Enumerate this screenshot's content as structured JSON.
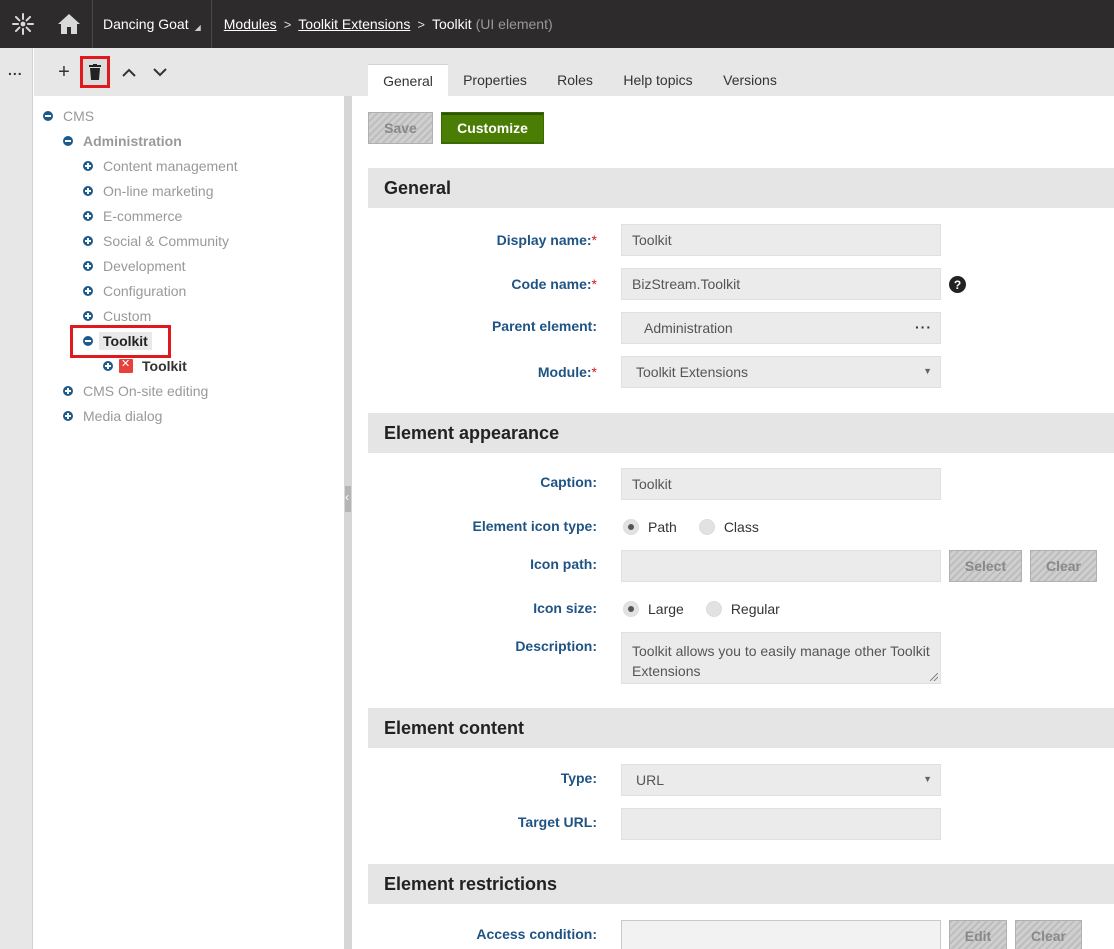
{
  "topbar": {
    "site": "Dancing Goat",
    "breadcrumbs": [
      {
        "label": "Modules",
        "link": true
      },
      {
        "label": "Toolkit Extensions",
        "link": true
      }
    ],
    "current": "Toolkit",
    "current_suffix": "(UI element)"
  },
  "strip": {
    "more": "..."
  },
  "tree_toolbar": {
    "add": "+",
    "up": "up",
    "down": "down"
  },
  "tree": {
    "root": "CMS",
    "administration": "Administration",
    "items": [
      "Content management",
      "On-line marketing",
      "E-commerce",
      "Social & Community",
      "Development",
      "Configuration",
      "Custom"
    ],
    "selected": "Toolkit",
    "child": "Toolkit",
    "after": [
      "CMS On-site editing",
      "Media dialog"
    ]
  },
  "tabs": [
    "General",
    "Properties",
    "Roles",
    "Help topics",
    "Versions"
  ],
  "actions": {
    "save": "Save",
    "customize": "Customize"
  },
  "sections": {
    "general": "General",
    "appearance": "Element appearance",
    "content": "Element content",
    "restrictions": "Element restrictions"
  },
  "fields": {
    "display_name": {
      "label": "Display name:",
      "value": "Toolkit"
    },
    "code_name": {
      "label": "Code name:",
      "value": "BizStream.Toolkit"
    },
    "parent": {
      "label": "Parent element:",
      "value": "Administration"
    },
    "module": {
      "label": "Module:",
      "value": "Toolkit Extensions"
    },
    "caption": {
      "label": "Caption:",
      "value": "Toolkit"
    },
    "icon_type": {
      "label": "Element icon type:",
      "options": [
        "Path",
        "Class"
      ],
      "selected": "Path"
    },
    "icon_path": {
      "label": "Icon path:",
      "value": "",
      "select": "Select",
      "clear": "Clear"
    },
    "icon_size": {
      "label": "Icon size:",
      "options": [
        "Large",
        "Regular"
      ],
      "selected": "Large"
    },
    "description": {
      "label": "Description:",
      "value": "Toolkit allows you to easily manage other Toolkit Extensions"
    },
    "type": {
      "label": "Type:",
      "value": "URL"
    },
    "target_url": {
      "label": "Target URL:",
      "value": ""
    },
    "access": {
      "label": "Access condition:",
      "edit": "Edit",
      "clear": "Clear"
    }
  },
  "required_mark": "*",
  "help_mark": "?"
}
